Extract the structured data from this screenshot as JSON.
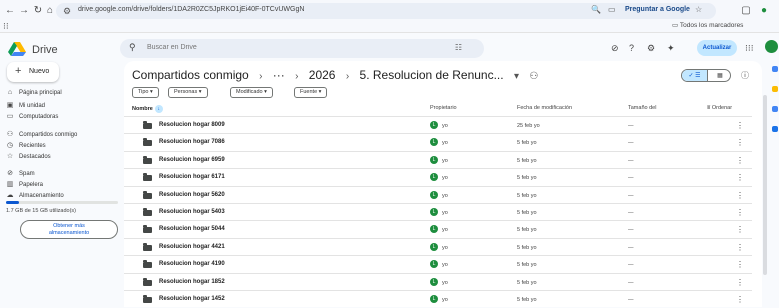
{
  "browser": {
    "url": "drive.google.com/drive/folders/1DA2R0ZC5JpRKO1jEi40F-0TCvUWGgN",
    "ask_google": "Preguntar a Google",
    "bookmarks": "Todos los marcadores"
  },
  "app": {
    "brand": "Drive",
    "search_placeholder": "Buscar en Drive",
    "update_label": "Actualizar"
  },
  "sidebar": {
    "new_label": "Nuevo",
    "items": [
      {
        "label": "Página principal",
        "icon": "home-icon"
      },
      {
        "label": "Mi unidad",
        "icon": "drive-icon"
      },
      {
        "label": "Computadoras",
        "icon": "computer-icon"
      },
      {
        "label": "Compartidos conmigo",
        "icon": "people-icon"
      },
      {
        "label": "Recientes",
        "icon": "clock-icon"
      },
      {
        "label": "Destacados",
        "icon": "star-icon"
      },
      {
        "label": "Spam",
        "icon": "spam-icon"
      },
      {
        "label": "Papelera",
        "icon": "trash-icon"
      },
      {
        "label": "Almacenamiento",
        "icon": "cloud-icon"
      }
    ],
    "storage_text": "1.7 GB de 15 GB utilizado(s)",
    "storage_fraction": 0.113,
    "more_storage_line1": "Obtener más",
    "more_storage_line2": "almacenamiento"
  },
  "breadcrumb": {
    "root": "Compartidos conmigo",
    "ellipsis": "···",
    "year": "2026",
    "current": "5. Resolucion de Renunc..."
  },
  "filters": [
    "Tipo",
    "Personas",
    "Modificado",
    "Fuente"
  ],
  "table": {
    "headers": {
      "name": "Nombre",
      "owner": "Propietario",
      "modified": "Fecha de modificación",
      "size": "Tamaño del",
      "sort": "Ordenar"
    },
    "rows": [
      {
        "name": "Resolucion hogar 8009",
        "owner": "yo",
        "modified": "25 feb yo",
        "size": "—"
      },
      {
        "name": "Resolucion hogar 7086",
        "owner": "yo",
        "modified": "5 feb yo",
        "size": "—"
      },
      {
        "name": "Resolucion hogar 6959",
        "owner": "yo",
        "modified": "5 feb yo",
        "size": "—"
      },
      {
        "name": "Resolucion hogar 6171",
        "owner": "yo",
        "modified": "5 feb yo",
        "size": "—"
      },
      {
        "name": "Resolucion hogar 5620",
        "owner": "yo",
        "modified": "5 feb yo",
        "size": "—"
      },
      {
        "name": "Resolucion hogar 5403",
        "owner": "yo",
        "modified": "5 feb yo",
        "size": "—"
      },
      {
        "name": "Resolucion hogar 5044",
        "owner": "yo",
        "modified": "5 feb yo",
        "size": "—"
      },
      {
        "name": "Resolucion hogar 4421",
        "owner": "yo",
        "modified": "5 feb yo",
        "size": "—"
      },
      {
        "name": "Resolucion hogar 4190",
        "owner": "yo",
        "modified": "5 feb yo",
        "size": "—"
      },
      {
        "name": "Resolucion hogar 1852",
        "owner": "yo",
        "modified": "5 feb yo",
        "size": "—"
      },
      {
        "name": "Resolucion hogar 1452",
        "owner": "yo",
        "modified": "5 feb yo",
        "size": "—"
      }
    ]
  },
  "colors": {
    "accent": "#0b57d0",
    "owner_avatar": "#1e8e3e"
  }
}
